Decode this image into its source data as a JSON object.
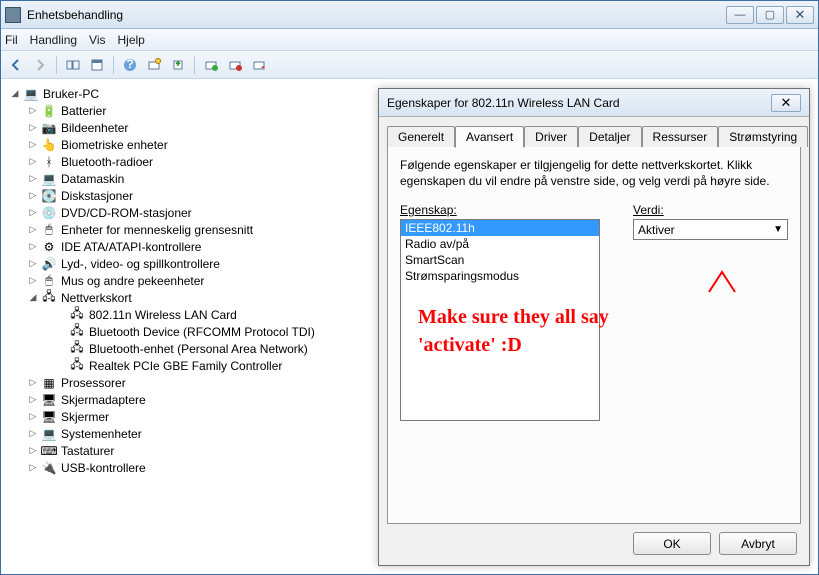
{
  "window": {
    "title": "Enhetsbehandling",
    "minimize": "—",
    "maximize": "▢",
    "close": "✕"
  },
  "menu": {
    "file": "Fil",
    "action": "Handling",
    "view": "Vis",
    "help": "Hjelp"
  },
  "tree": {
    "root": "Bruker-PC",
    "items": [
      "Batterier",
      "Bildeenheter",
      "Biometriske enheter",
      "Bluetooth-radioer",
      "Datamaskin",
      "Diskstasjoner",
      "DVD/CD-ROM-stasjoner",
      "Enheter for menneskelig grensesnitt",
      "IDE ATA/ATAPI-kontrollere",
      "Lyd-, video- og spillkontrollere",
      "Mus og andre pekeenheter",
      "Nettverkskort",
      "Prosessorer",
      "Skjermadaptere",
      "Skjermer",
      "Systemenheter",
      "Tastaturer",
      "USB-kontrollere"
    ],
    "net_children": [
      "802.11n Wireless LAN Card",
      "Bluetooth Device (RFCOMM Protocol TDI)",
      "Bluetooth-enhet (Personal Area Network)",
      "Realtek PCIe GBE Family Controller"
    ]
  },
  "dialog": {
    "title": "Egenskaper for 802.11n Wireless LAN Card",
    "close": "✕",
    "tabs": [
      "Generelt",
      "Avansert",
      "Driver",
      "Detaljer",
      "Ressurser",
      "Strømstyring"
    ],
    "active_tab": 1,
    "description": "Følgende egenskaper er tilgjengelig for dette nettverkskortet. Klikk egenskapen du vil endre på venstre side, og velg verdi på høyre side.",
    "prop_label": "Egenskap:",
    "value_label": "Verdi:",
    "props": [
      "IEEE802.11h",
      "Radio av/på",
      "SmartScan",
      "Strømsparingsmodus"
    ],
    "selected_prop": 0,
    "value": "Aktiver",
    "ok": "OK",
    "cancel": "Avbryt"
  },
  "annotation": {
    "line1": "Make sure they all say",
    "line2": "'activate' :D"
  }
}
